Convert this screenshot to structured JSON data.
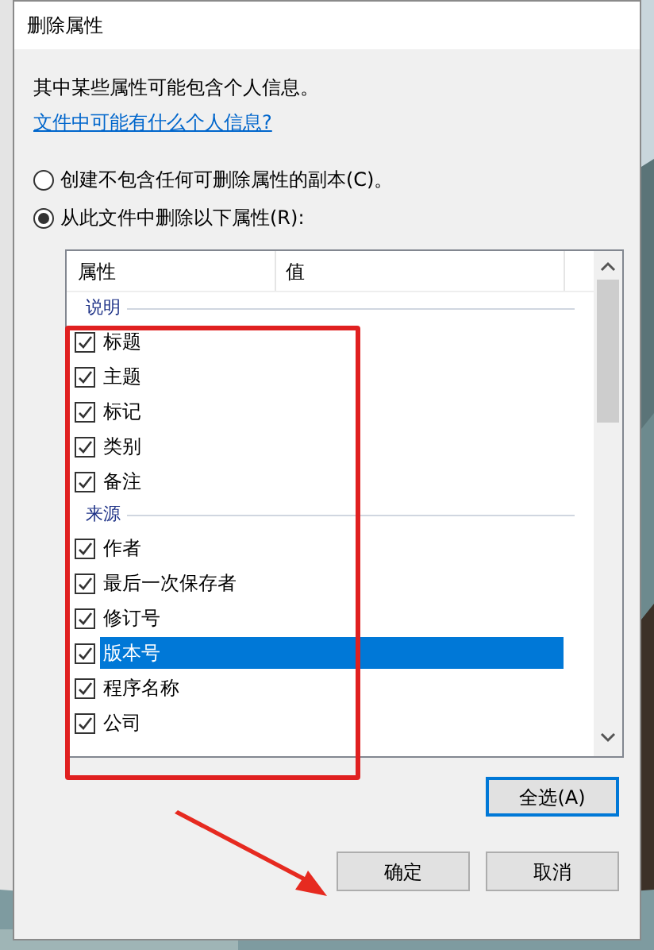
{
  "window": {
    "title": "删除属性"
  },
  "intro": "其中某些属性可能包含个人信息。",
  "help_link": "文件中可能有什么个人信息?",
  "options": [
    {
      "label": "创建不包含任何可删除属性的副本(C)。",
      "selected": false
    },
    {
      "label": "从此文件中删除以下属性(R):",
      "selected": true
    }
  ],
  "list": {
    "columns": [
      "属性",
      "值"
    ],
    "groups": [
      {
        "title": "说明",
        "items": [
          {
            "label": "标题",
            "checked": true,
            "selected": false
          },
          {
            "label": "主题",
            "checked": true,
            "selected": false
          },
          {
            "label": "标记",
            "checked": true,
            "selected": false
          },
          {
            "label": "类别",
            "checked": true,
            "selected": false
          },
          {
            "label": "备注",
            "checked": true,
            "selected": false
          }
        ]
      },
      {
        "title": "来源",
        "items": [
          {
            "label": "作者",
            "checked": true,
            "selected": false
          },
          {
            "label": "最后一次保存者",
            "checked": true,
            "selected": false
          },
          {
            "label": "修订号",
            "checked": true,
            "selected": false
          },
          {
            "label": "版本号",
            "checked": true,
            "selected": true
          },
          {
            "label": "程序名称",
            "checked": true,
            "selected": false
          },
          {
            "label": "公司",
            "checked": true,
            "selected": false
          }
        ]
      }
    ]
  },
  "select_all_button": "全选(A)",
  "buttons": [
    "确定",
    "取消"
  ]
}
